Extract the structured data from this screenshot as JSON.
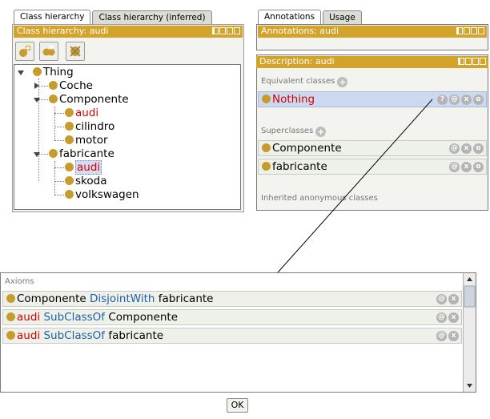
{
  "left_tabs": [
    "Class hierarchy",
    "Class hierarchy (inferred)"
  ],
  "right_tabs": [
    "Annotations",
    "Usage"
  ],
  "class_hierarchy_header": "Class hierarchy: audi",
  "annotations_header": "Annotations: audi",
  "description_header": "Description: audi",
  "tree": {
    "thing": "Thing",
    "coche": "Coche",
    "componente": "Componente",
    "audi_1": "audi",
    "cilindro": "cilindro",
    "motor": "motor",
    "fabricante": "fabricante",
    "audi_2": "audi",
    "skoda": "skoda",
    "volkswagen": "volkswagen"
  },
  "description": {
    "equivalent_label": "Equivalent classes",
    "equivalent_item": "Nothing",
    "superclasses_label": "Superclasses",
    "super_1": "Componente",
    "super_2": "fabricante",
    "inherited_label": "Inherited anonymous classes"
  },
  "axioms": {
    "label": "Axioms",
    "rows": [
      {
        "a": "Componente",
        "op": "DisjointWith",
        "b": "fabricante"
      },
      {
        "a": "audi",
        "op": "SubClassOf",
        "b": "Componente"
      },
      {
        "a": "audi",
        "op": "SubClassOf",
        "b": "fabricante"
      }
    ]
  },
  "ok_label": "OK",
  "icons": {
    "add": "+",
    "explain": "?",
    "annotate": "@",
    "delete": "x",
    "edit": "o"
  },
  "colors": {
    "header_gold": "#d4a32a",
    "class_dot": "#c89b2d",
    "entity_red": "#d40000",
    "keyword_blue": "#1f5fa6"
  }
}
